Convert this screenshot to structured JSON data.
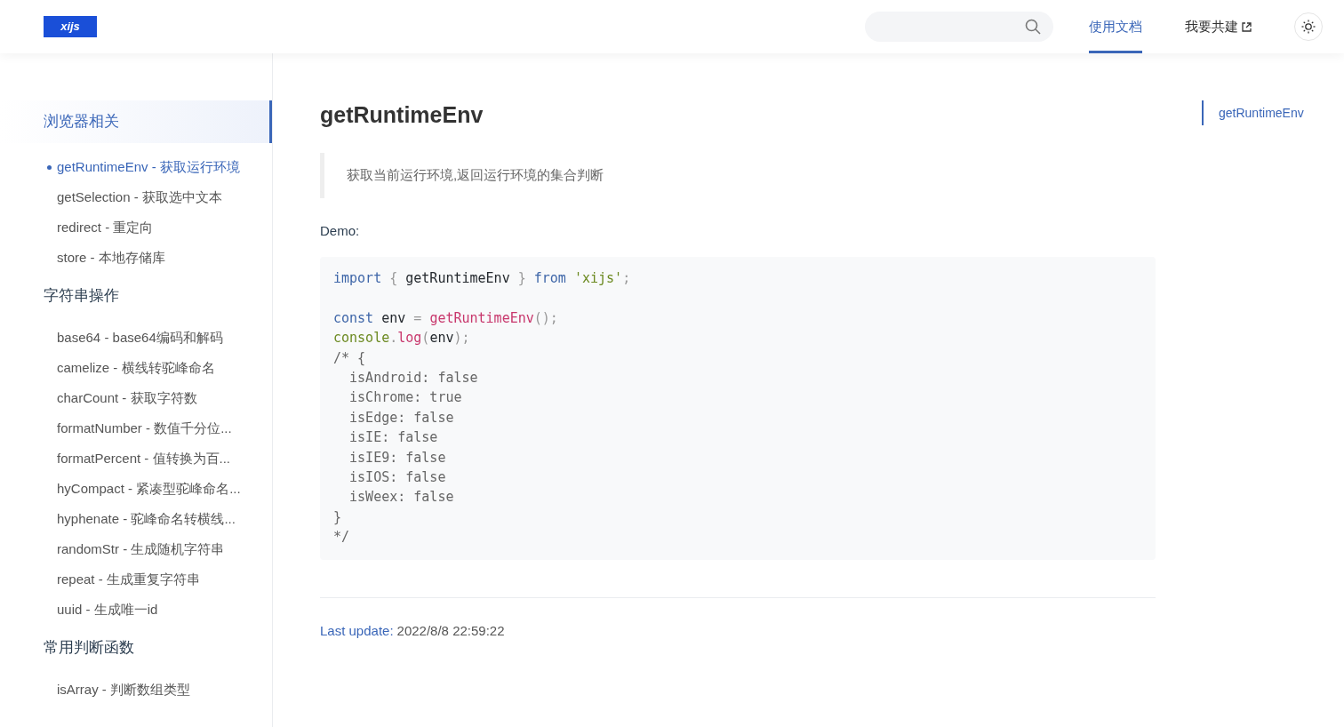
{
  "header": {
    "logo": "xijs",
    "nav": [
      {
        "label": "使用文档",
        "selected": true,
        "external": false
      },
      {
        "label": "我要共建",
        "selected": false,
        "external": true
      }
    ]
  },
  "sidebar": {
    "groups": [
      {
        "title": "浏览器相关",
        "selected": true,
        "items": [
          {
            "label": "getRuntimeEnv - 获取运行环境",
            "selected": true
          },
          {
            "label": "getSelection - 获取选中文本",
            "selected": false
          },
          {
            "label": "redirect - 重定向",
            "selected": false
          },
          {
            "label": "store - 本地存储库",
            "selected": false
          }
        ]
      },
      {
        "title": "字符串操作",
        "selected": false,
        "items": [
          {
            "label": "base64 - base64编码和解码",
            "selected": false
          },
          {
            "label": "camelize - 横线转驼峰命名",
            "selected": false
          },
          {
            "label": "charCount - 获取字符数",
            "selected": false
          },
          {
            "label": "formatNumber - 数值千分位...",
            "selected": false
          },
          {
            "label": "formatPercent - 值转换为百...",
            "selected": false
          },
          {
            "label": "hyCompact - 紧凑型驼峰命名...",
            "selected": false
          },
          {
            "label": "hyphenate - 驼峰命名转横线...",
            "selected": false
          },
          {
            "label": "randomStr - 生成随机字符串",
            "selected": false
          },
          {
            "label": "repeat - 生成重复字符串",
            "selected": false
          },
          {
            "label": "uuid - 生成唯一id",
            "selected": false
          }
        ]
      },
      {
        "title": "常用判断函数",
        "selected": false,
        "items": [
          {
            "label": "isArray - 判断数组类型",
            "selected": false
          }
        ]
      }
    ]
  },
  "content": {
    "title": "getRuntimeEnv",
    "quote": "获取当前运行环境,返回运行环境的集合判断",
    "demo_label": "Demo:",
    "code": [
      {
        "blank_before": false,
        "tokens": [
          {
            "t": "import",
            "kind": "keyword"
          },
          {
            "t": " { ",
            "kind": "punct"
          },
          {
            "t": "getRuntimeEnv",
            "kind": "plain"
          },
          {
            "t": " } ",
            "kind": "punct"
          },
          {
            "t": "from",
            "kind": "keyword"
          },
          {
            "t": " 'xijs'",
            "kind": "string"
          },
          {
            "t": ";",
            "kind": "punct"
          }
        ]
      },
      {
        "blank_before": true,
        "tokens": [
          {
            "t": "const",
            "kind": "keyword"
          },
          {
            "t": " env",
            "kind": "plain"
          },
          {
            "t": " = ",
            "kind": "punct"
          },
          {
            "t": "getRuntimeEnv",
            "kind": "func"
          },
          {
            "t": "();",
            "kind": "punct"
          }
        ]
      },
      {
        "blank_before": false,
        "tokens": [
          {
            "t": "console",
            "kind": "builtin"
          },
          {
            "t": ".",
            "kind": "punct"
          },
          {
            "t": "log",
            "kind": "func"
          },
          {
            "t": "(",
            "kind": "punct"
          },
          {
            "t": "env",
            "kind": "plain"
          },
          {
            "t": ");",
            "kind": "punct"
          }
        ]
      },
      {
        "blank_before": false,
        "tokens": [
          {
            "t": "/* {",
            "kind": "comment"
          }
        ]
      },
      {
        "blank_before": false,
        "tokens": [
          {
            "t": "  isAndroid: false",
            "kind": "comment"
          }
        ]
      },
      {
        "blank_before": false,
        "tokens": [
          {
            "t": "  isChrome: true",
            "kind": "comment"
          }
        ]
      },
      {
        "blank_before": false,
        "tokens": [
          {
            "t": "  isEdge: false",
            "kind": "comment"
          }
        ]
      },
      {
        "blank_before": false,
        "tokens": [
          {
            "t": "  isIE: false",
            "kind": "comment"
          }
        ]
      },
      {
        "blank_before": false,
        "tokens": [
          {
            "t": "  isIE9: false",
            "kind": "comment"
          }
        ]
      },
      {
        "blank_before": false,
        "tokens": [
          {
            "t": "  isIOS: false",
            "kind": "comment"
          }
        ]
      },
      {
        "blank_before": false,
        "tokens": [
          {
            "t": "  isWeex: false",
            "kind": "comment"
          }
        ]
      },
      {
        "blank_before": false,
        "tokens": [
          {
            "t": "}",
            "kind": "comment"
          }
        ]
      },
      {
        "blank_before": false,
        "tokens": [
          {
            "t": "*/",
            "kind": "comment"
          }
        ]
      }
    ],
    "last_update": {
      "label": "Last update:",
      "value": "2022/8/8 22:59:22"
    }
  },
  "toc": [
    {
      "label": "getRuntimeEnv",
      "selected": true
    }
  ]
}
